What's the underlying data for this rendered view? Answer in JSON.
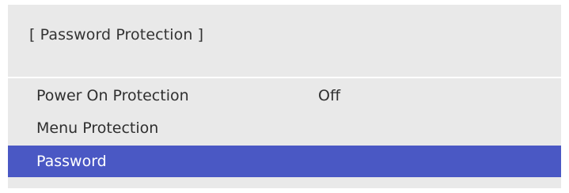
{
  "dialog": {
    "title": "[ Password Protection ]"
  },
  "menu": {
    "items": [
      {
        "label": "Power On Protection",
        "value": "Off"
      },
      {
        "label": "Menu Protection",
        "value": ""
      },
      {
        "label": "Password",
        "value": ""
      }
    ],
    "selected_index": 2
  },
  "colors": {
    "panel_background": "#e9e9e9",
    "selection_highlight": "#4a58c4",
    "selected_text": "#ffffff",
    "text": "#2f2f2f"
  }
}
